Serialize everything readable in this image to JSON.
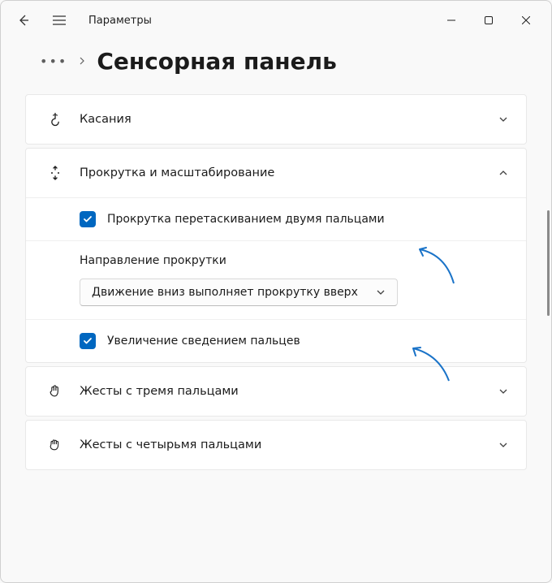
{
  "window": {
    "app_title": "Параметры"
  },
  "breadcrumb": {
    "page_title": "Сенсорная панель"
  },
  "sections": {
    "taps": {
      "title": "Касания"
    },
    "scroll": {
      "title": "Прокрутка и масштабирование",
      "two_finger_drag": "Прокрутка перетаскиванием двумя пальцами",
      "direction_heading": "Направление прокрутки",
      "direction_value": "Движение вниз выполняет прокрутку вверх",
      "pinch_zoom": "Увеличение сведением пальцев"
    },
    "three_finger": {
      "title": "Жесты с тремя пальцами"
    },
    "four_finger": {
      "title": "Жесты с четырьмя пальцами"
    }
  }
}
